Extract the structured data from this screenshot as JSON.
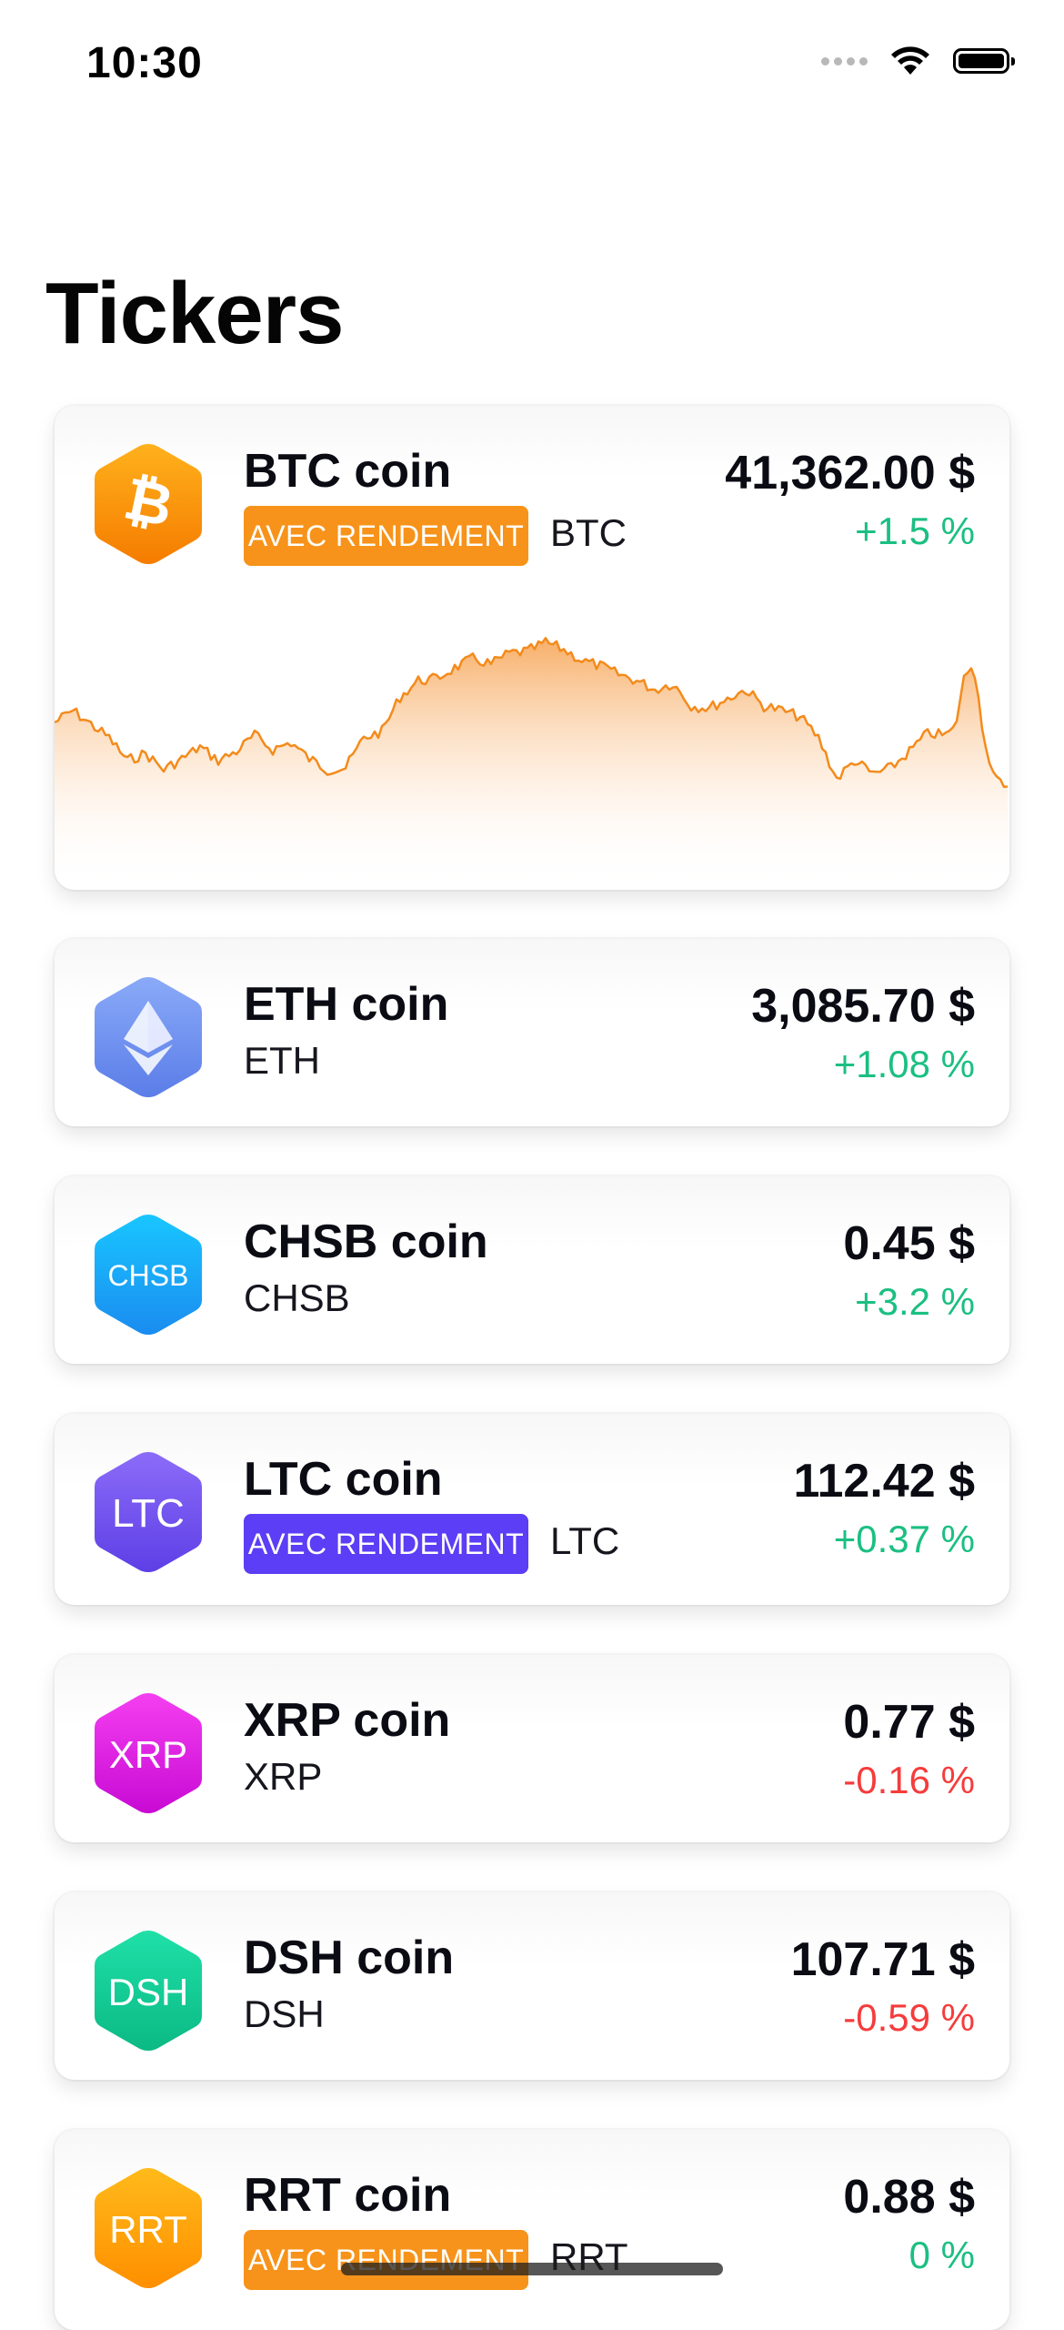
{
  "status_bar": {
    "time": "10:30",
    "icons": [
      "signal-dots-icon",
      "wifi-icon",
      "battery-icon"
    ]
  },
  "page": {
    "title": "Tickers"
  },
  "colors": {
    "positive": "#1bbf82",
    "negative": "#f53c3c",
    "badge_orange": "#f7931a",
    "badge_purple": "#5b3ef5"
  },
  "tickers": [
    {
      "name": "BTC coin",
      "symbol": "BTC",
      "icon": "bitcoin-icon",
      "icon_label": "",
      "icon_colors": [
        "#ffb11c",
        "#f57c00"
      ],
      "badge": "AVEC RENDEMENT",
      "badge_color": "#f7931a",
      "price": "41,362.00 $",
      "change": "+1.5 %",
      "direction": "up",
      "has_chart": true
    },
    {
      "name": "ETH coin",
      "symbol": "ETH",
      "icon": "ethereum-icon",
      "icon_label": "",
      "icon_colors": [
        "#8aaaf8",
        "#5b7de8"
      ],
      "badge": null,
      "price": "3,085.70 $",
      "change": "+1.08 %",
      "direction": "up"
    },
    {
      "name": "CHSB coin",
      "symbol": "CHSB",
      "icon": "chsb-icon",
      "icon_label": "CHSB",
      "icon_colors": [
        "#19c6ff",
        "#1a8cf0"
      ],
      "badge": null,
      "price": "0.45 $",
      "change": "+3.2 %",
      "direction": "up"
    },
    {
      "name": "LTC coin",
      "symbol": "LTC",
      "icon": "ltc-icon",
      "icon_label": "LTC",
      "icon_colors": [
        "#8b6cf8",
        "#5e3fe6"
      ],
      "badge": "AVEC RENDEMENT",
      "badge_color": "#5b3ef5",
      "price": "112.42 $",
      "change": "+0.37 %",
      "direction": "up"
    },
    {
      "name": "XRP coin",
      "symbol": "XRP",
      "icon": "xrp-icon",
      "icon_label": "XRP",
      "icon_colors": [
        "#f43ff0",
        "#c80ad4"
      ],
      "badge": null,
      "price": "0.77 $",
      "change": "-0.16 %",
      "direction": "down"
    },
    {
      "name": "DSH coin",
      "symbol": "DSH",
      "icon": "dsh-icon",
      "icon_label": "DSH",
      "icon_colors": [
        "#1fe0a8",
        "#0bb984"
      ],
      "badge": null,
      "price": "107.71 $",
      "change": "-0.59 %",
      "direction": "down"
    },
    {
      "name": "RRT coin",
      "symbol": "RRT",
      "icon": "rrt-icon",
      "icon_label": "RRT",
      "icon_colors": [
        "#ffba1a",
        "#ff8f00"
      ],
      "badge": "AVEC RENDEMENT",
      "badge_color": "#f7931a",
      "price": "0.88 $",
      "change": "0 %",
      "direction": "up"
    }
  ]
}
